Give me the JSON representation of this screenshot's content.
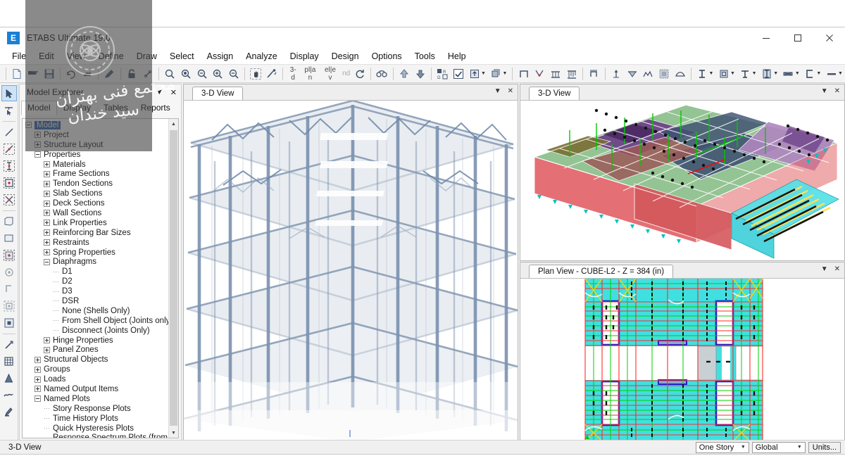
{
  "window": {
    "app_icon_letter": "E",
    "title": "ETABS Ultimate 19.0",
    "minimize": "minimize-button",
    "maximize": "maximize-button",
    "close": "close-button"
  },
  "menubar": {
    "items": [
      {
        "label": "File",
        "accel": "F"
      },
      {
        "label": "Edit",
        "accel": "E"
      },
      {
        "label": "View",
        "accel": "V"
      },
      {
        "label": "Define",
        "accel": "D"
      },
      {
        "label": "Draw",
        "accel": "r"
      },
      {
        "label": "Select",
        "accel": "S"
      },
      {
        "label": "Assign",
        "accel": "A"
      },
      {
        "label": "Analyze",
        "accel": "n"
      },
      {
        "label": "Display",
        "accel": "i"
      },
      {
        "label": "Design",
        "accel": "g"
      },
      {
        "label": "Options",
        "accel": "O"
      },
      {
        "label": "Tools",
        "accel": "T"
      },
      {
        "label": "Help",
        "accel": "H"
      }
    ]
  },
  "toolbar": {
    "text_buttons": [
      {
        "label": "3-d",
        "dim": false
      },
      {
        "label": "pl|a n",
        "dim": false
      },
      {
        "label": "el|e v",
        "dim": false
      },
      {
        "label": "nd",
        "dim": true
      }
    ],
    "icons": [
      "new-file-icon",
      "open-file-icon",
      "save-icon",
      "undo-icon",
      "redo-icon",
      "pencil-edit-icon",
      "lock-icon",
      "run-analysis-icon",
      "zoom-window-icon",
      "zoom-previous-icon",
      "zoom-out-full-icon",
      "zoom-in-icon",
      "zoom-out-icon",
      "pan-icon",
      "rubber-band-zoom-icon",
      "view-3d-icon",
      "plan-view-icon",
      "elevation-view-icon",
      "nd-view-icon",
      "refresh-view-icon",
      "perspective-toggle-icon",
      "move-up-story-icon",
      "move-down-story-icon",
      "object-select-icon",
      "check-model-icon",
      "set-display-options-icon",
      "display-options-caret",
      "object-fill-icon",
      "object-fill-caret",
      "set-building-view-icon",
      "joint-assign-icon",
      "frame-load-icon",
      "shell-load-icon",
      "section-cut-icon",
      "joint-reactions-icon",
      "frame-forces-icon",
      "shell-forces-icon",
      "deformed-shape-icon",
      "mode-shape-icon",
      "steel-design-icon",
      "steel-caret",
      "concrete-design-icon",
      "concrete-caret",
      "composite-beam-icon",
      "composite-caret",
      "column-design-icon",
      "column-caret",
      "shear-wall-icon",
      "shear-caret",
      "section-designer-icon",
      "section-caret",
      "slab-design-icon",
      "slab-caret"
    ]
  },
  "left_toolbar": {
    "items": [
      "pointer-select-icon",
      "reshape-object-icon",
      "draw-line-icon",
      "draw-beam-icon",
      "draw-column-icon",
      "quick-draw-beam-icon",
      "quick-draw-brace-icon",
      "draw-floor-icon",
      "draw-wall-icon",
      "quick-draw-wall-icon",
      "draw-point-icon",
      "draw-section-cut-icon",
      "draw-dimension-icon",
      "draw-reference-point-icon",
      "draw-developed-elevation-icon",
      "snap-intersection-icon",
      "grid-snap-icon",
      "snap-perpendicular-icon",
      "snap-midpoint-icon",
      "draw-pencil-icon"
    ],
    "selected": "pointer-select-icon"
  },
  "explorer": {
    "title": "Model Explorer",
    "collapse_icon": "chevron-down-icon",
    "close_icon": "close-icon",
    "tabs": [
      {
        "label": "Model",
        "active": true
      },
      {
        "label": "Display",
        "active": false
      },
      {
        "label": "Tables",
        "active": false
      },
      {
        "label": "Reports",
        "active": false
      }
    ],
    "tree": [
      {
        "label": "Model",
        "depth": 0,
        "toggle": "minus",
        "selected": true
      },
      {
        "label": "Project",
        "depth": 1,
        "toggle": "plus"
      },
      {
        "label": "Structure Layout",
        "depth": 1,
        "toggle": "plus"
      },
      {
        "label": "Properties",
        "depth": 1,
        "toggle": "minus"
      },
      {
        "label": "Materials",
        "depth": 2,
        "toggle": "plus"
      },
      {
        "label": "Frame Sections",
        "depth": 2,
        "toggle": "plus"
      },
      {
        "label": "Tendon Sections",
        "depth": 2,
        "toggle": "plus"
      },
      {
        "label": "Slab Sections",
        "depth": 2,
        "toggle": "plus"
      },
      {
        "label": "Deck Sections",
        "depth": 2,
        "toggle": "plus"
      },
      {
        "label": "Wall Sections",
        "depth": 2,
        "toggle": "plus"
      },
      {
        "label": "Link Properties",
        "depth": 2,
        "toggle": "plus"
      },
      {
        "label": "Reinforcing Bar Sizes",
        "depth": 2,
        "toggle": "plus"
      },
      {
        "label": "Restraints",
        "depth": 2,
        "toggle": "plus"
      },
      {
        "label": "Spring Properties",
        "depth": 2,
        "toggle": "plus"
      },
      {
        "label": "Diaphragms",
        "depth": 2,
        "toggle": "minus"
      },
      {
        "label": "D1",
        "depth": 3,
        "toggle": "leaf"
      },
      {
        "label": "D2",
        "depth": 3,
        "toggle": "leaf"
      },
      {
        "label": "D3",
        "depth": 3,
        "toggle": "leaf"
      },
      {
        "label": "DSR",
        "depth": 3,
        "toggle": "leaf"
      },
      {
        "label": "None (Shells Only)",
        "depth": 3,
        "toggle": "leaf"
      },
      {
        "label": "From Shell Object (Joints only)",
        "depth": 3,
        "toggle": "leaf"
      },
      {
        "label": "Disconnect (Joints Only)",
        "depth": 3,
        "toggle": "leaf"
      },
      {
        "label": "Hinge Properties",
        "depth": 2,
        "toggle": "plus"
      },
      {
        "label": "Panel Zones",
        "depth": 2,
        "toggle": "plus"
      },
      {
        "label": "Structural Objects",
        "depth": 1,
        "toggle": "plus"
      },
      {
        "label": "Groups",
        "depth": 1,
        "toggle": "plus"
      },
      {
        "label": "Loads",
        "depth": 1,
        "toggle": "plus"
      },
      {
        "label": "Named Output Items",
        "depth": 1,
        "toggle": "plus"
      },
      {
        "label": "Named Plots",
        "depth": 1,
        "toggle": "minus"
      },
      {
        "label": "Story Response Plots",
        "depth": 2,
        "toggle": "leaf"
      },
      {
        "label": "Time History Plots",
        "depth": 2,
        "toggle": "leaf"
      },
      {
        "label": "Quick Hysteresis Plots",
        "depth": 2,
        "toggle": "leaf"
      },
      {
        "label": "Response Spectrum Plots (from TH)",
        "depth": 2,
        "toggle": "leaf"
      }
    ]
  },
  "panes": {
    "main_3d": {
      "tab_label": "3-D View",
      "collapse_icon": "chevron-down-icon",
      "close_icon": "close-icon"
    },
    "side_3d": {
      "tab_label": "3-D View",
      "collapse_icon": "chevron-down-icon",
      "close_icon": "close-icon"
    },
    "plan": {
      "tab_label": "Plan View - CUBE-L2 - Z = 384 (in)",
      "collapse_icon": "chevron-down-icon",
      "close_icon": "close-icon"
    }
  },
  "statusbar": {
    "view_label": "3-D View",
    "story_select": "One Story",
    "coord_select": "Global",
    "units_button": "Units..."
  },
  "watermark": {
    "line1": "مجتمع فنی بهتران",
    "line2": "سید خندان"
  },
  "colors": {
    "accent": "#1b7fd4",
    "title_text": "#111111",
    "selection": "#2a63b0",
    "steel_frame": "#6e87a8",
    "plan_fill": "#40e0e0",
    "plan_grid_red": "#ff2b2b",
    "plan_grid_green": "#00d000",
    "plan_wall_blue": "#2222cc",
    "model_red": "#e2656a",
    "model_green": "#7fb57f",
    "model_purple": "#7d4f93",
    "model_blue": "#41567a",
    "model_cyan": "#57e0e8",
    "model_yellow": "#ffe14d"
  }
}
